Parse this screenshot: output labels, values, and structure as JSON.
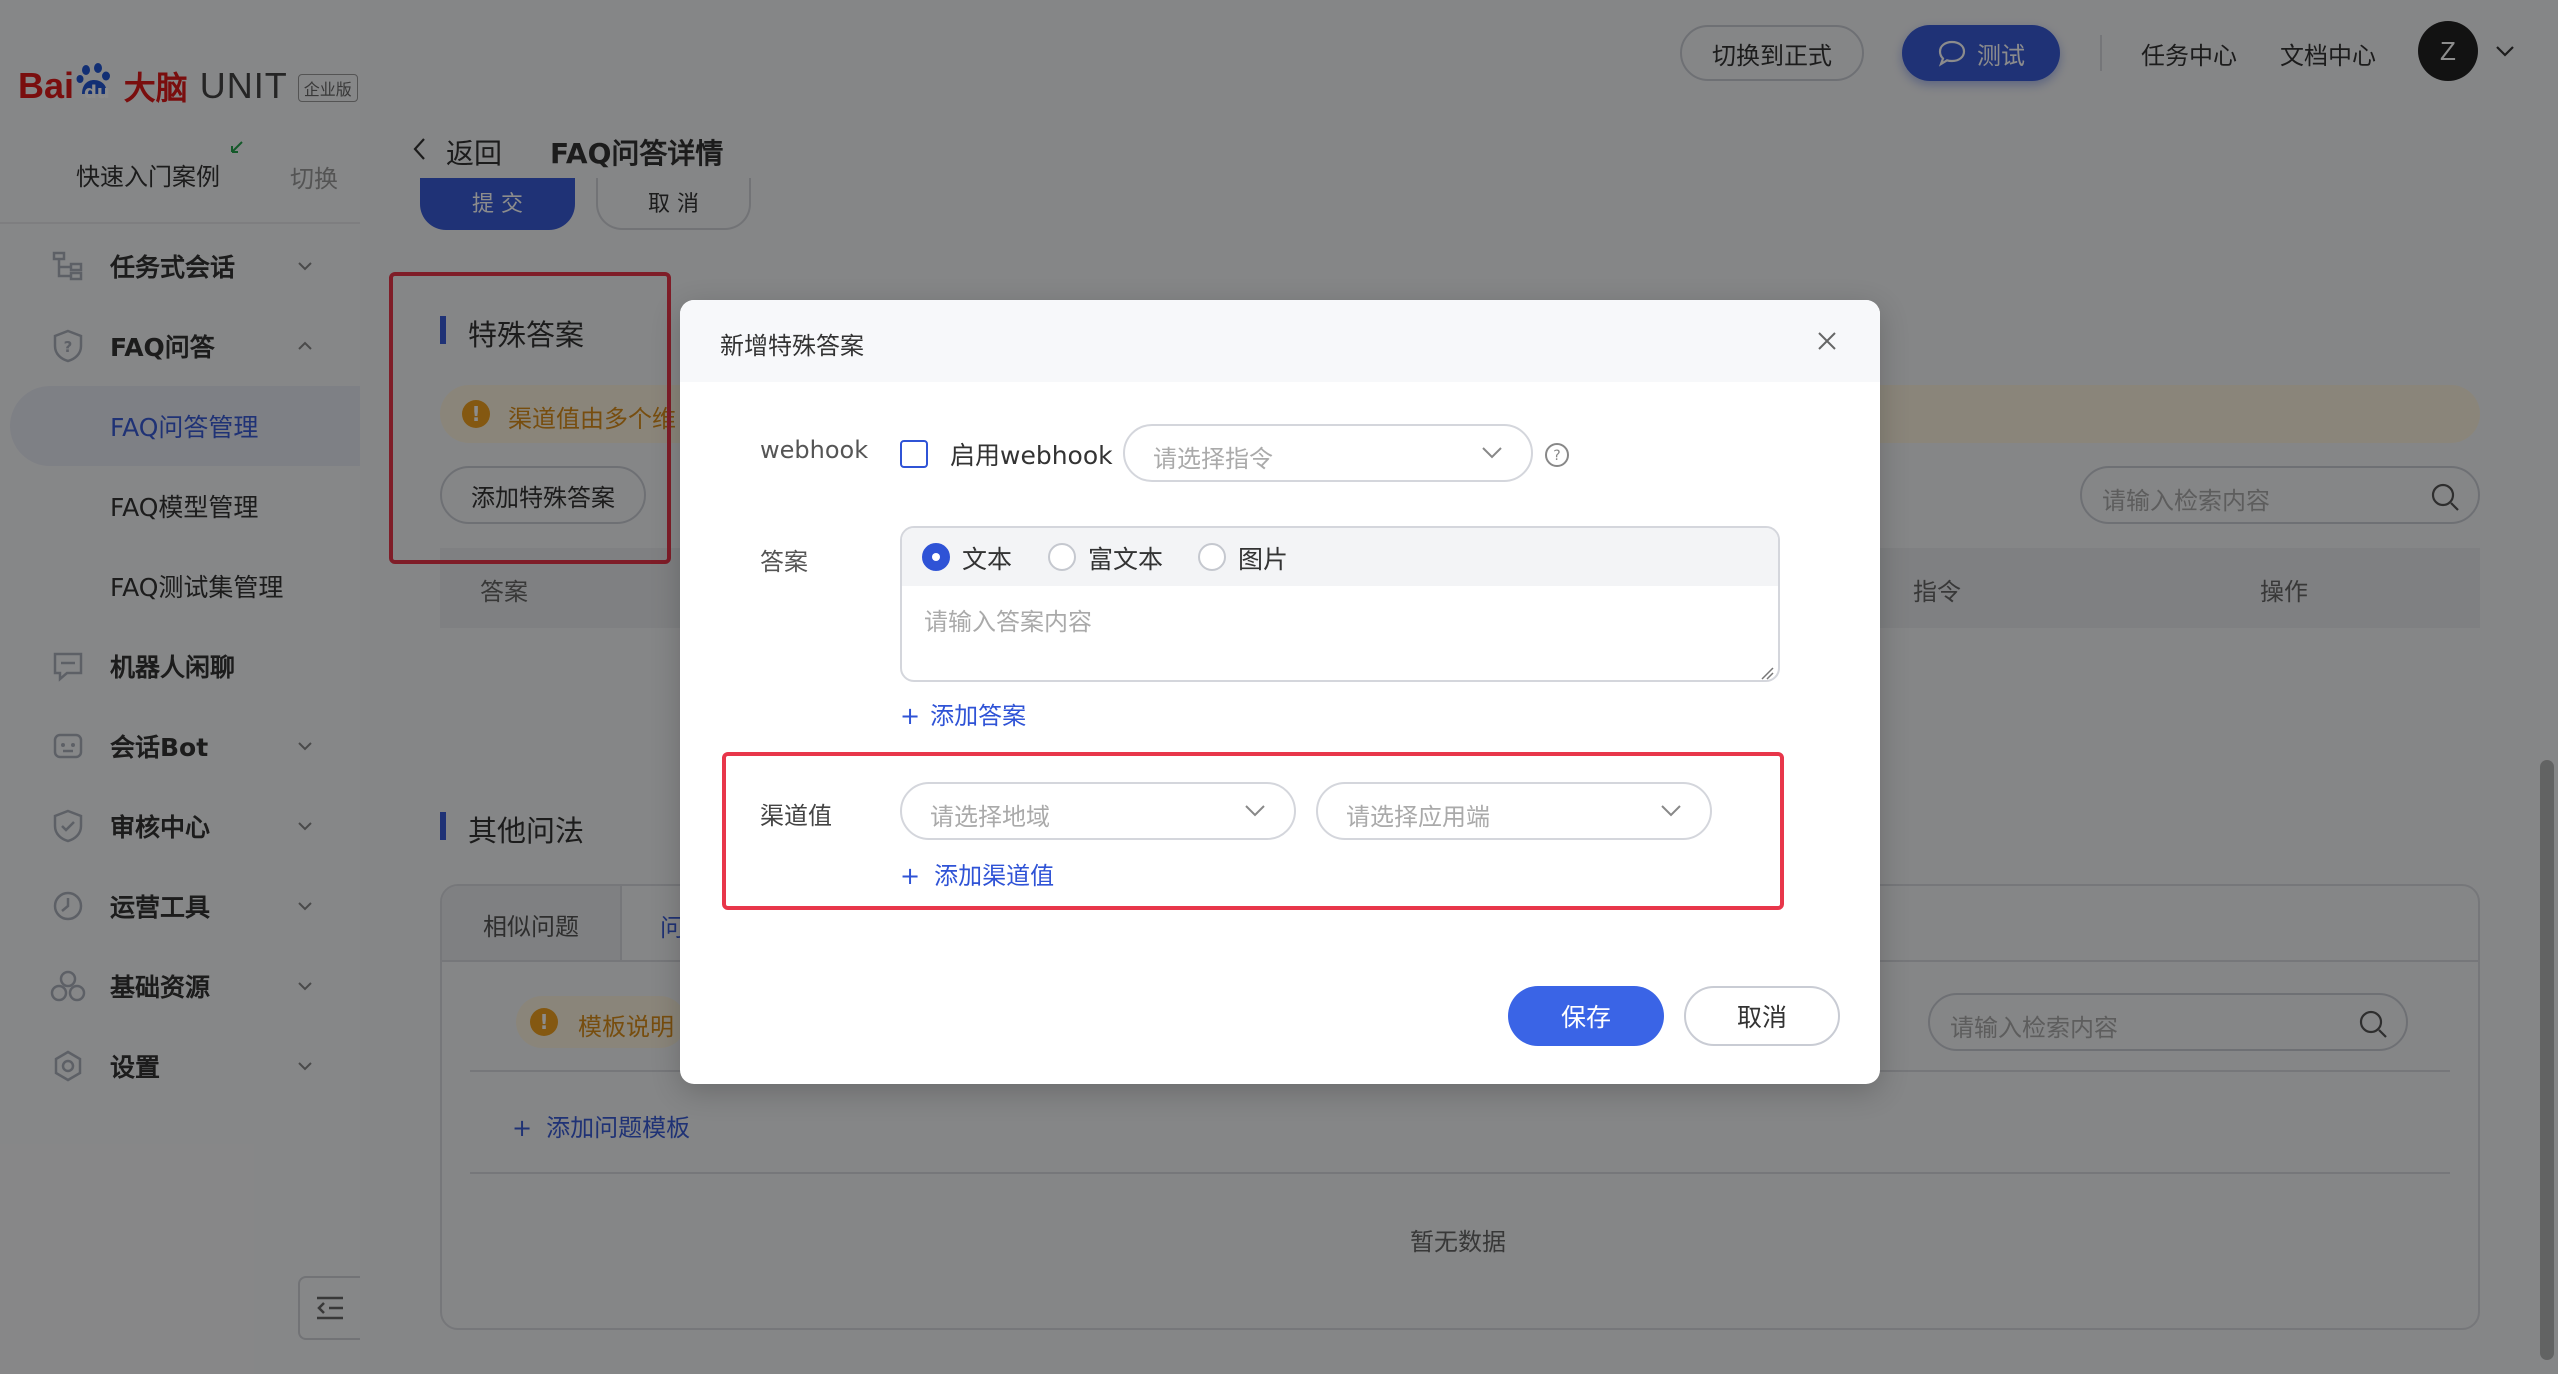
{
  "brand": {
    "logo_bai": "Bai",
    "logo_du": "du",
    "logo_danao": "大脑",
    "product": "UNIT",
    "edition": "企业版"
  },
  "sidebar": {
    "quick_start": "快速入门案例",
    "switch": "切换",
    "items": [
      {
        "label": "任务式会话",
        "icon": "flow-icon",
        "expandable": true,
        "expanded": false
      },
      {
        "label": "FAQ问答",
        "icon": "question-shield-icon",
        "expandable": true,
        "expanded": true
      },
      {
        "label": "FAQ问答管理",
        "sub": true,
        "active": true
      },
      {
        "label": "FAQ模型管理",
        "sub": true
      },
      {
        "label": "FAQ测试集管理",
        "sub": true
      },
      {
        "label": "机器人闲聊",
        "icon": "chat-icon",
        "expandable": false
      },
      {
        "label": "会话Bot",
        "icon": "bot-icon",
        "expandable": true
      },
      {
        "label": "审核中心",
        "icon": "shield-check-icon",
        "expandable": true
      },
      {
        "label": "运营工具",
        "icon": "clock-icon",
        "expandable": true
      },
      {
        "label": "基础资源",
        "icon": "cubes-icon",
        "expandable": true
      },
      {
        "label": "设置",
        "icon": "gear-icon",
        "expandable": true
      }
    ]
  },
  "header": {
    "switch_prod": "切换到正式",
    "test": "测试",
    "task_center": "任务中心",
    "doc_center": "文档中心",
    "avatar_initial": "Z"
  },
  "page": {
    "back": "返回",
    "title": "FAQ问答详情",
    "submit": "提 交",
    "cancel": "取 消"
  },
  "special_answers": {
    "title": "特殊答案",
    "notice": "渠道值由多个维",
    "add_button": "添加特殊答案",
    "search_placeholder": "请输入检索内容",
    "columns": [
      "答案",
      "指令",
      "操作"
    ]
  },
  "other_questions": {
    "title": "其他问法",
    "tabs": [
      "相似问题",
      "问"
    ],
    "template_notice": "模板说明",
    "add_template": "添加问题模板",
    "search_placeholder": "请输入检索内容",
    "empty": "暂无数据"
  },
  "modal": {
    "title": "新增特殊答案",
    "webhook_label": "webhook",
    "enable_webhook": "启用webhook",
    "enable_webhook_checked": false,
    "command_placeholder": "请选择指令",
    "answer_label": "答案",
    "answer_types": [
      {
        "label": "文本",
        "selected": true
      },
      {
        "label": "富文本",
        "selected": false
      },
      {
        "label": "图片",
        "selected": false
      }
    ],
    "answer_placeholder": "请输入答案内容",
    "add_answer": "添加答案",
    "channel_label": "渠道值",
    "region_placeholder": "请选择地域",
    "app_placeholder": "请选择应用端",
    "add_channel": "添加渠道值",
    "save": "保存",
    "cancel": "取消"
  },
  "colors": {
    "accent": "#3a5cd8",
    "highlight_box": "#e8364a",
    "warning": "#f0a020"
  }
}
